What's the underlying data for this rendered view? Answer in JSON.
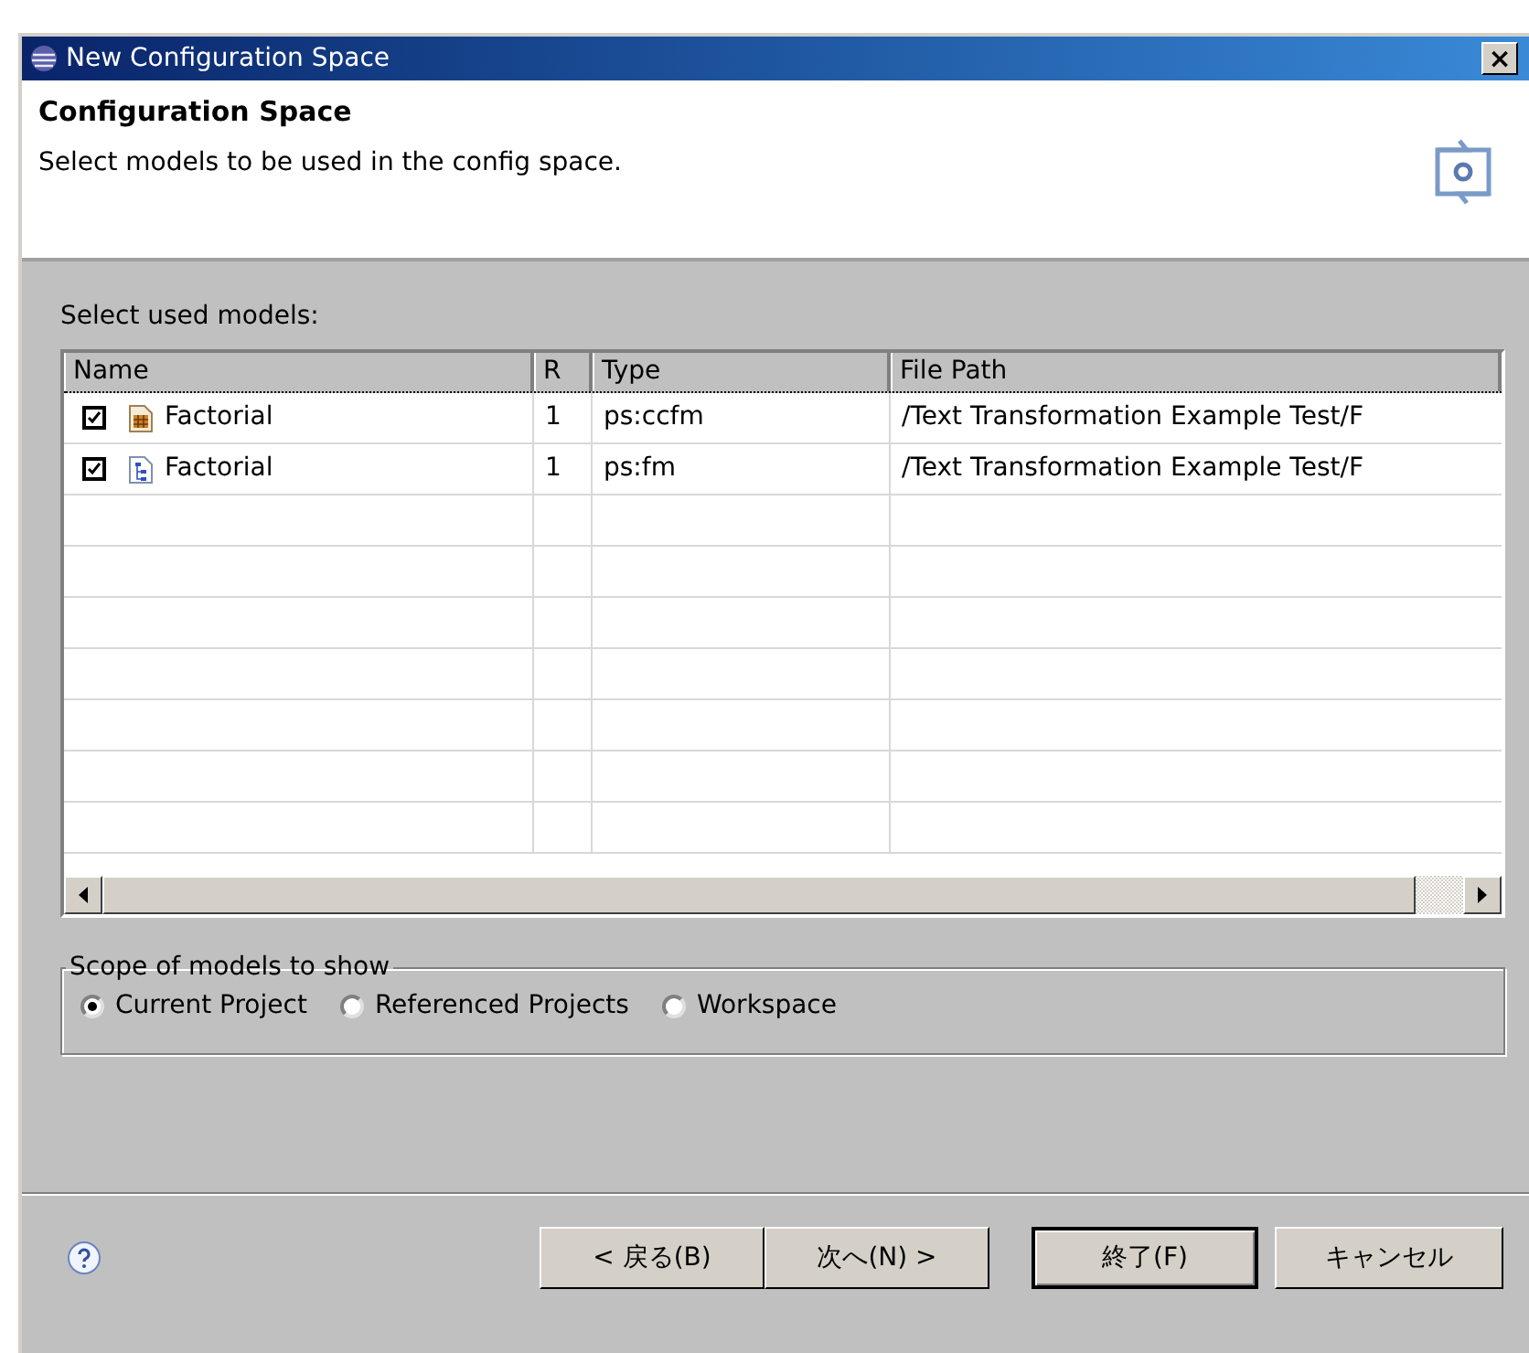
{
  "window": {
    "title": "New Configuration Space",
    "close": "×"
  },
  "header": {
    "title": "Configuration Space",
    "description": "Select models to be used in the config space."
  },
  "table": {
    "label": "Select used models:",
    "columns": [
      "Name",
      "R",
      "Type",
      "File Path"
    ],
    "rows": [
      {
        "checked": true,
        "kind": "ccfm",
        "name": "Factorial",
        "r": "1",
        "type": "ps:ccfm",
        "path": "/Text Transformation Example Test/F"
      },
      {
        "checked": true,
        "kind": "fm",
        "name": "Factorial",
        "r": "1",
        "type": "ps:fm",
        "path": "/Text Transformation Example Test/F"
      }
    ]
  },
  "scope": {
    "label": "Scope of models to show",
    "options": [
      {
        "label": "Current Project",
        "selected": true
      },
      {
        "label": "Referenced Projects",
        "selected": false
      },
      {
        "label": "Workspace",
        "selected": false
      }
    ]
  },
  "buttons": [
    {
      "label": "< 戻る(B)",
      "default": false
    },
    {
      "label": "次へ(N) >",
      "default": false
    },
    {
      "label": "終了(F)",
      "default": true
    },
    {
      "label": "キャンセル",
      "default": false
    }
  ]
}
